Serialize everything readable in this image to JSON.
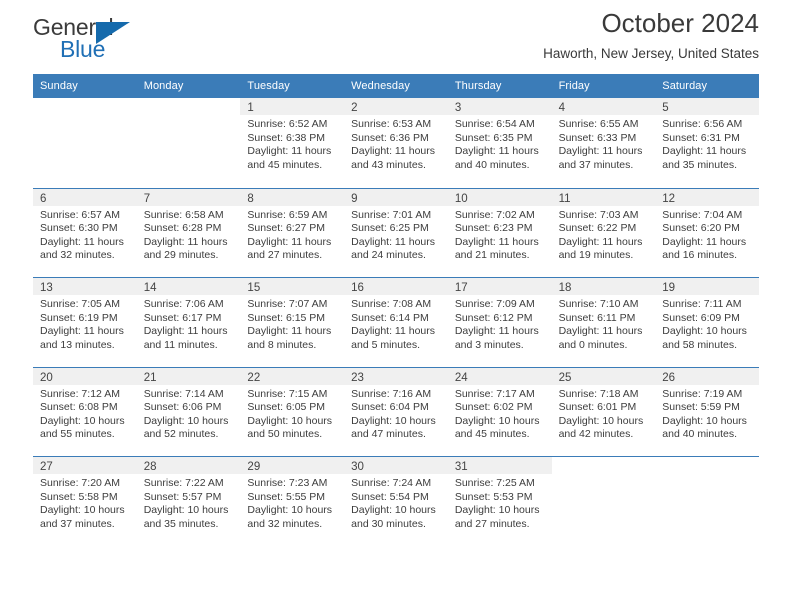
{
  "brand": {
    "name_part1": "General",
    "name_part2": "Blue",
    "logo_icon": "blue-triangle-icon",
    "accent_color": "#1f6fb5"
  },
  "header": {
    "title": "October 2024",
    "subtitle": "Haworth, New Jersey, United States"
  },
  "calendar": {
    "header_bg": "#3b7cb8",
    "daynum_band_bg": "#f0f0f0",
    "weekdays": [
      "Sunday",
      "Monday",
      "Tuesday",
      "Wednesday",
      "Thursday",
      "Friday",
      "Saturday"
    ],
    "weeks": [
      [
        {
          "day": "",
          "sunrise": "",
          "sunset": "",
          "daylight": ""
        },
        {
          "day": "",
          "sunrise": "",
          "sunset": "",
          "daylight": ""
        },
        {
          "day": "1",
          "sunrise": "Sunrise: 6:52 AM",
          "sunset": "Sunset: 6:38 PM",
          "daylight": "Daylight: 11 hours and 45 minutes."
        },
        {
          "day": "2",
          "sunrise": "Sunrise: 6:53 AM",
          "sunset": "Sunset: 6:36 PM",
          "daylight": "Daylight: 11 hours and 43 minutes."
        },
        {
          "day": "3",
          "sunrise": "Sunrise: 6:54 AM",
          "sunset": "Sunset: 6:35 PM",
          "daylight": "Daylight: 11 hours and 40 minutes."
        },
        {
          "day": "4",
          "sunrise": "Sunrise: 6:55 AM",
          "sunset": "Sunset: 6:33 PM",
          "daylight": "Daylight: 11 hours and 37 minutes."
        },
        {
          "day": "5",
          "sunrise": "Sunrise: 6:56 AM",
          "sunset": "Sunset: 6:31 PM",
          "daylight": "Daylight: 11 hours and 35 minutes."
        }
      ],
      [
        {
          "day": "6",
          "sunrise": "Sunrise: 6:57 AM",
          "sunset": "Sunset: 6:30 PM",
          "daylight": "Daylight: 11 hours and 32 minutes."
        },
        {
          "day": "7",
          "sunrise": "Sunrise: 6:58 AM",
          "sunset": "Sunset: 6:28 PM",
          "daylight": "Daylight: 11 hours and 29 minutes."
        },
        {
          "day": "8",
          "sunrise": "Sunrise: 6:59 AM",
          "sunset": "Sunset: 6:27 PM",
          "daylight": "Daylight: 11 hours and 27 minutes."
        },
        {
          "day": "9",
          "sunrise": "Sunrise: 7:01 AM",
          "sunset": "Sunset: 6:25 PM",
          "daylight": "Daylight: 11 hours and 24 minutes."
        },
        {
          "day": "10",
          "sunrise": "Sunrise: 7:02 AM",
          "sunset": "Sunset: 6:23 PM",
          "daylight": "Daylight: 11 hours and 21 minutes."
        },
        {
          "day": "11",
          "sunrise": "Sunrise: 7:03 AM",
          "sunset": "Sunset: 6:22 PM",
          "daylight": "Daylight: 11 hours and 19 minutes."
        },
        {
          "day": "12",
          "sunrise": "Sunrise: 7:04 AM",
          "sunset": "Sunset: 6:20 PM",
          "daylight": "Daylight: 11 hours and 16 minutes."
        }
      ],
      [
        {
          "day": "13",
          "sunrise": "Sunrise: 7:05 AM",
          "sunset": "Sunset: 6:19 PM",
          "daylight": "Daylight: 11 hours and 13 minutes."
        },
        {
          "day": "14",
          "sunrise": "Sunrise: 7:06 AM",
          "sunset": "Sunset: 6:17 PM",
          "daylight": "Daylight: 11 hours and 11 minutes."
        },
        {
          "day": "15",
          "sunrise": "Sunrise: 7:07 AM",
          "sunset": "Sunset: 6:15 PM",
          "daylight": "Daylight: 11 hours and 8 minutes."
        },
        {
          "day": "16",
          "sunrise": "Sunrise: 7:08 AM",
          "sunset": "Sunset: 6:14 PM",
          "daylight": "Daylight: 11 hours and 5 minutes."
        },
        {
          "day": "17",
          "sunrise": "Sunrise: 7:09 AM",
          "sunset": "Sunset: 6:12 PM",
          "daylight": "Daylight: 11 hours and 3 minutes."
        },
        {
          "day": "18",
          "sunrise": "Sunrise: 7:10 AM",
          "sunset": "Sunset: 6:11 PM",
          "daylight": "Daylight: 11 hours and 0 minutes."
        },
        {
          "day": "19",
          "sunrise": "Sunrise: 7:11 AM",
          "sunset": "Sunset: 6:09 PM",
          "daylight": "Daylight: 10 hours and 58 minutes."
        }
      ],
      [
        {
          "day": "20",
          "sunrise": "Sunrise: 7:12 AM",
          "sunset": "Sunset: 6:08 PM",
          "daylight": "Daylight: 10 hours and 55 minutes."
        },
        {
          "day": "21",
          "sunrise": "Sunrise: 7:14 AM",
          "sunset": "Sunset: 6:06 PM",
          "daylight": "Daylight: 10 hours and 52 minutes."
        },
        {
          "day": "22",
          "sunrise": "Sunrise: 7:15 AM",
          "sunset": "Sunset: 6:05 PM",
          "daylight": "Daylight: 10 hours and 50 minutes."
        },
        {
          "day": "23",
          "sunrise": "Sunrise: 7:16 AM",
          "sunset": "Sunset: 6:04 PM",
          "daylight": "Daylight: 10 hours and 47 minutes."
        },
        {
          "day": "24",
          "sunrise": "Sunrise: 7:17 AM",
          "sunset": "Sunset: 6:02 PM",
          "daylight": "Daylight: 10 hours and 45 minutes."
        },
        {
          "day": "25",
          "sunrise": "Sunrise: 7:18 AM",
          "sunset": "Sunset: 6:01 PM",
          "daylight": "Daylight: 10 hours and 42 minutes."
        },
        {
          "day": "26",
          "sunrise": "Sunrise: 7:19 AM",
          "sunset": "Sunset: 5:59 PM",
          "daylight": "Daylight: 10 hours and 40 minutes."
        }
      ],
      [
        {
          "day": "27",
          "sunrise": "Sunrise: 7:20 AM",
          "sunset": "Sunset: 5:58 PM",
          "daylight": "Daylight: 10 hours and 37 minutes."
        },
        {
          "day": "28",
          "sunrise": "Sunrise: 7:22 AM",
          "sunset": "Sunset: 5:57 PM",
          "daylight": "Daylight: 10 hours and 35 minutes."
        },
        {
          "day": "29",
          "sunrise": "Sunrise: 7:23 AM",
          "sunset": "Sunset: 5:55 PM",
          "daylight": "Daylight: 10 hours and 32 minutes."
        },
        {
          "day": "30",
          "sunrise": "Sunrise: 7:24 AM",
          "sunset": "Sunset: 5:54 PM",
          "daylight": "Daylight: 10 hours and 30 minutes."
        },
        {
          "day": "31",
          "sunrise": "Sunrise: 7:25 AM",
          "sunset": "Sunset: 5:53 PM",
          "daylight": "Daylight: 10 hours and 27 minutes."
        },
        {
          "day": "",
          "sunrise": "",
          "sunset": "",
          "daylight": ""
        },
        {
          "day": "",
          "sunrise": "",
          "sunset": "",
          "daylight": ""
        }
      ]
    ]
  }
}
